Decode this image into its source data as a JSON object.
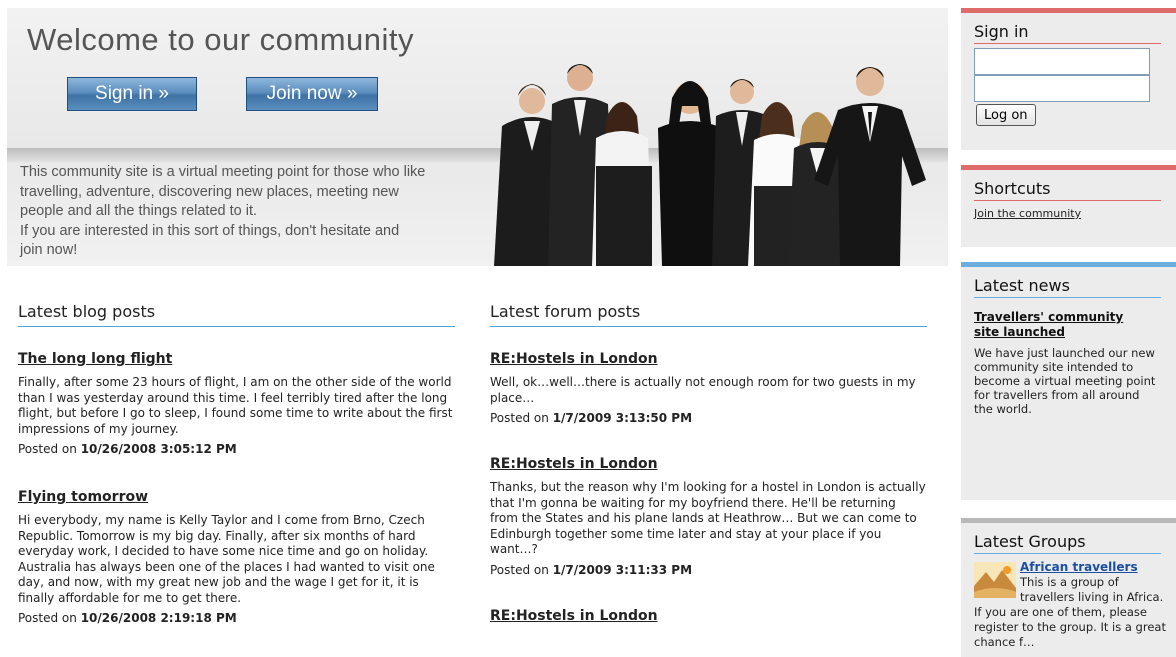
{
  "banner": {
    "heading": "Welcome to our community",
    "signin_button": "Sign in »",
    "join_button": "Join now »",
    "intro_lines": [
      "This community site is a virtual meeting point for those who like",
      "travelling, adventure, discovering new places, meeting new",
      "people and all the things related to it.",
      "If you are interested in this sort of things, don't hesitate and",
      "join now!"
    ]
  },
  "blog": {
    "title": "Latest blog posts",
    "posts": [
      {
        "title": "The long long flight",
        "body": "Finally, after some 23 hours of flight, I am on the other side of the world than I was yesterday around this time. I feel terribly tired after the long flight, but before I go to sleep, I found some time to write about the first impressions of my journey.",
        "posted_label": "Posted on",
        "posted_date": "10/26/2008 3:05:12 PM"
      },
      {
        "title": "Flying tomorrow",
        "body": "Hi everybody, my name is Kelly Taylor and I come from Brno, Czech Republic. Tomorrow is my big day. Finally, after six months of hard everyday work, I decided to have some nice time and go on holiday. Australia has always been one of the places I had wanted to visit one day, and now, with my great new job and the wage I get for it, it is finally affordable for me to get there.",
        "posted_label": "Posted on",
        "posted_date": "10/26/2008 2:19:18 PM"
      }
    ]
  },
  "forum": {
    "title": "Latest forum posts",
    "posts": [
      {
        "title": "RE:Hostels in London",
        "body": "Well, ok…well…there is actually not enough room for two guests in my place…",
        "posted_label": "Posted on",
        "posted_date": "1/7/2009 3:13:50 PM"
      },
      {
        "title": "RE:Hostels in London",
        "body": "Thanks, but the reason why I'm looking for a hostel in London is actually that I'm gonna be waiting for my boyfriend there. He'll be returning from the States and his plane lands at Heathrow… But we can come to Edinburgh together some time later and stay at your place if you want…?",
        "posted_label": "Posted on",
        "posted_date": "1/7/2009 3:11:33 PM"
      },
      {
        "title": "RE:Hostels in London"
      }
    ]
  },
  "sidebar": {
    "signin": {
      "title": "Sign in",
      "username_value": "",
      "password_value": "",
      "logon_button": "Log on"
    },
    "shortcuts": {
      "title": "Shortcuts",
      "links": [
        "Join the community"
      ]
    },
    "news": {
      "title": "Latest news",
      "item_title": "Travellers' community site launched",
      "item_body": "We have just launched our new community site intended to become a virtual meeting point for travellers from all around the world."
    },
    "groups": {
      "title": "Latest Groups",
      "item_name": "African travellers",
      "item_desc": "This is a group of travellers living in Africa. If you are one of them, please register to the group. It is a great chance f…"
    }
  },
  "colors": {
    "accent_red": "#e06b6b",
    "accent_blue": "#6aaee0",
    "button_blue": "#4a7db0",
    "link_blue": "#1a4ea0"
  }
}
